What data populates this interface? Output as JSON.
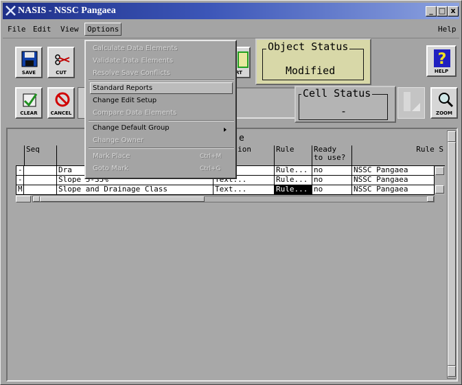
{
  "window": {
    "title": "NASIS - NSSC Pangaea",
    "controls": {
      "minimize": "_",
      "maximize": "□",
      "close": "x"
    }
  },
  "menubar": {
    "items": [
      "File",
      "Edit",
      "View",
      "Options"
    ],
    "help": "Help",
    "open_menu": "Options"
  },
  "toolbar": {
    "buttons": [
      {
        "label": "SAVE",
        "icon": "floppy-disk-icon"
      },
      {
        "label": "CUT",
        "icon": "scissors-icon"
      },
      {
        "label": "RT",
        "icon": "report-icon"
      },
      {
        "label": "HELP",
        "icon": "question-mark-icon"
      },
      {
        "label": "CLEAR",
        "icon": "clear-icon"
      },
      {
        "label": "CANCEL",
        "icon": "no-entry-icon"
      },
      {
        "label": "ZOOM",
        "icon": "magnifier-icon"
      }
    ]
  },
  "object_status": {
    "title": "Object Status",
    "value": "Modified"
  },
  "cell_status": {
    "title": "Cell Status",
    "value": "-"
  },
  "grid": {
    "title_fragment": "e",
    "columns": [
      "Seq",
      "",
      "cription",
      "Rule",
      "Ready to use?",
      "Rule S"
    ],
    "ready_line1": "Ready",
    "ready_line2": "to use?",
    "rows": [
      {
        "marker": "-",
        "seq": "",
        "name": "Dra",
        "desc": "t...",
        "rule": "Rule...",
        "ready": "no",
        "source": "NSSC Pangaea"
      },
      {
        "marker": "-",
        "seq": "",
        "name": "Slope 5-35%",
        "desc": "Text...",
        "rule": "Rule...",
        "ready": "no",
        "source": "NSSC Pangaea"
      },
      {
        "marker": "M",
        "seq": "",
        "name": "Slope and Drainage Class",
        "desc": "Text...",
        "rule": "Rule...",
        "ready": "no",
        "source": "NSSC Pangaea"
      }
    ]
  },
  "options_menu": {
    "items": [
      {
        "label": "Calculate Data Elements",
        "enabled": false
      },
      {
        "label": "Validate Data Elements",
        "enabled": false
      },
      {
        "label": "Resolve Save Conflicts",
        "enabled": false
      },
      {
        "label": "Standard Reports",
        "enabled": true,
        "highlighted": true
      },
      {
        "label": "Change Edit Setup",
        "enabled": true
      },
      {
        "label": "Compare Data Elements",
        "enabled": false
      },
      {
        "label": "Change Default Group",
        "enabled": true,
        "submenu": true
      },
      {
        "label": "Change Owner",
        "enabled": false
      },
      {
        "label": "Mark Place",
        "enabled": false,
        "accelerator": "Ctrl+M"
      },
      {
        "label": "Goto Mark",
        "enabled": false,
        "accelerator": "Ctrl+G"
      }
    ]
  },
  "colors": {
    "titlebar_start": "#1e2f88",
    "titlebar_end": "#8ca2e0",
    "object_status_bg": "#d8d8a8",
    "panel_bg": "#a4a4a4",
    "selected_cell_bg": "#000000"
  }
}
